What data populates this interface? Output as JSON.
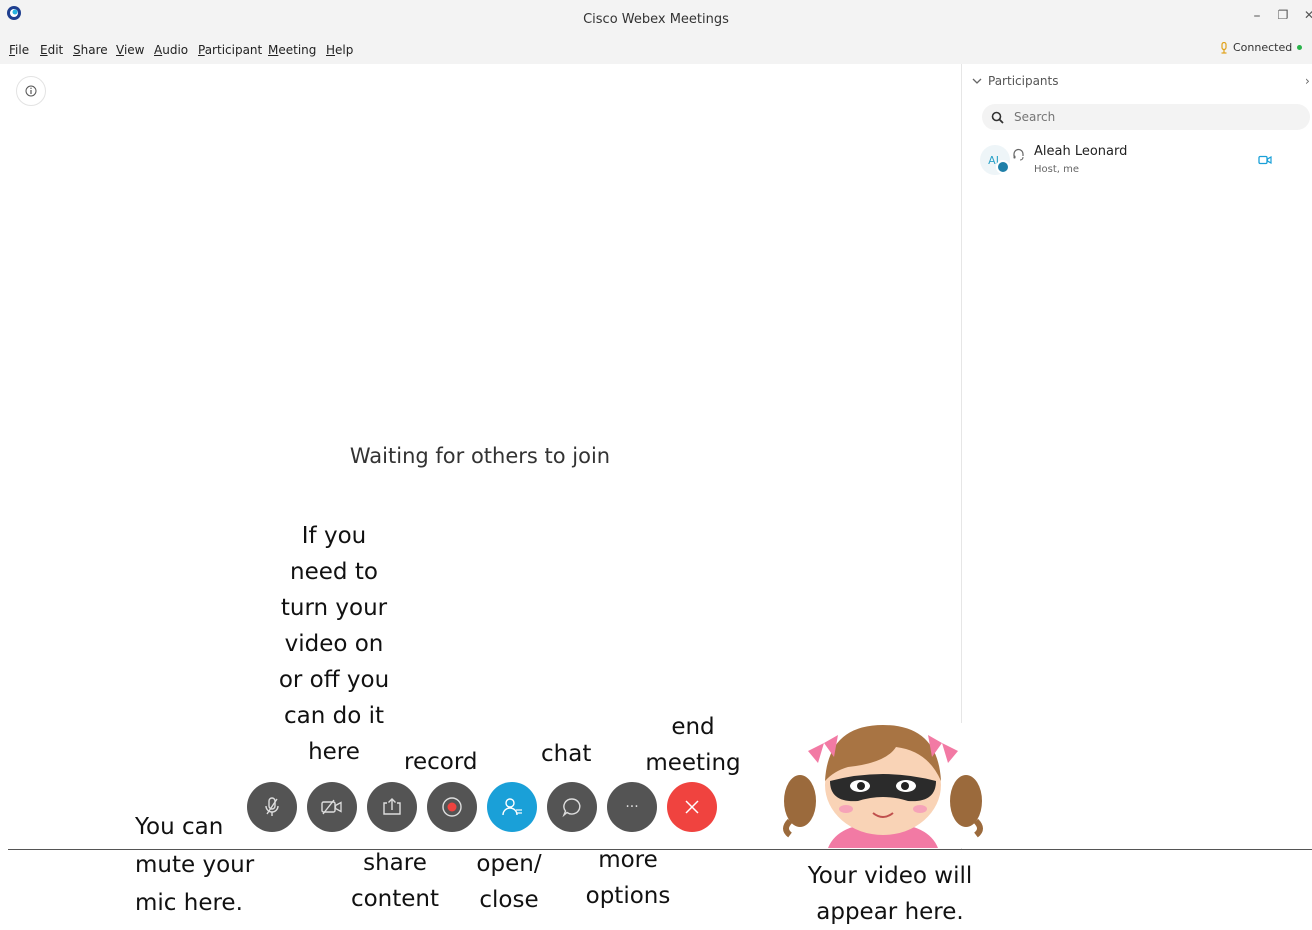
{
  "window": {
    "title": "Cisco Webex Meetings",
    "minimize_glyph": "–",
    "restore_glyph": "❐",
    "close_glyph": "✕"
  },
  "menu": [
    "File",
    "Edit",
    "Share",
    "View",
    "Audio",
    "Participant",
    "Meeting",
    "Help"
  ],
  "status": {
    "connection": "Connected",
    "connection_color": "#29b34a"
  },
  "main": {
    "waiting_message": "Waiting for others to join"
  },
  "participants_panel": {
    "title": "Participants",
    "search_placeholder": "Search",
    "participants": [
      {
        "initials": "AL",
        "name": "Aleah Leonard",
        "role": "Host, me"
      }
    ]
  },
  "controls": [
    {
      "name": "mute",
      "icon": "microphone-muted-icon",
      "color": "#545454"
    },
    {
      "name": "video",
      "icon": "video-off-icon",
      "color": "#545454"
    },
    {
      "name": "share",
      "icon": "share-icon",
      "color": "#545454"
    },
    {
      "name": "record",
      "icon": "record-icon",
      "color": "#545454"
    },
    {
      "name": "participants",
      "icon": "participants-icon",
      "color": "#1aa0d8"
    },
    {
      "name": "chat",
      "icon": "chat-icon",
      "color": "#545454"
    },
    {
      "name": "more",
      "icon": "more-icon",
      "glyph": "···",
      "color": "#545454"
    },
    {
      "name": "end",
      "icon": "end-meeting-icon",
      "color": "#f0433f"
    }
  ],
  "annotations": {
    "video_lines": [
      "If you",
      "need to",
      "turn your",
      "video on",
      "or off you",
      "can do it",
      "here"
    ],
    "record": "record",
    "chat": "chat",
    "end_lines": [
      "end",
      "meeting"
    ],
    "mute_lines": [
      "You can",
      "mute your",
      "mic here."
    ],
    "share_lines": [
      "share",
      "content"
    ],
    "open_close_lines": [
      "open/",
      "close"
    ],
    "more_lines": [
      "more",
      "options"
    ],
    "preview_lines": [
      "Your video will",
      "appear here."
    ]
  }
}
